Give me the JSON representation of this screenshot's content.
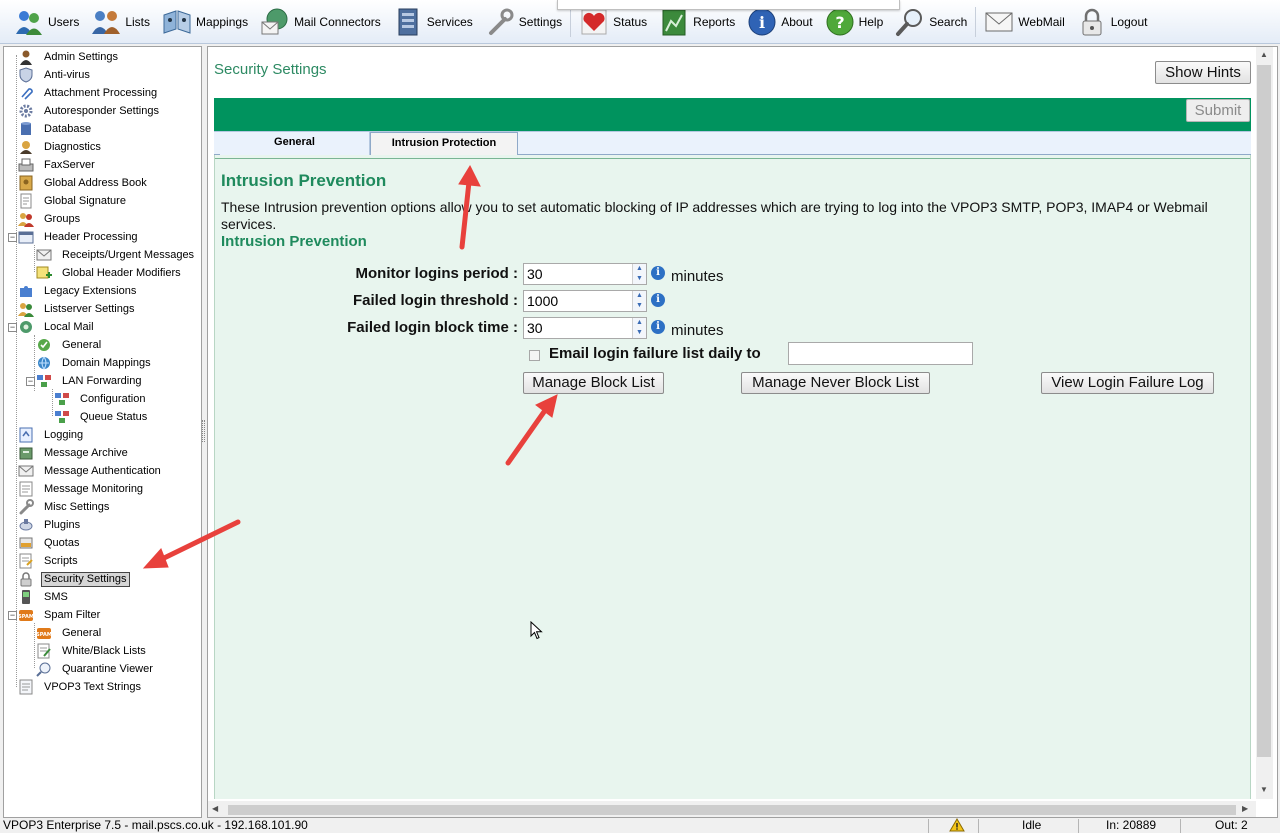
{
  "toolbar": {
    "items": [
      {
        "label": "Users",
        "icon": "users-icon"
      },
      {
        "label": "Lists",
        "icon": "lists-icon"
      },
      {
        "label": "Mappings",
        "icon": "mappings-icon"
      },
      {
        "label": "Mail Connectors",
        "icon": "mail-connectors-icon"
      },
      {
        "label": "Services",
        "icon": "services-icon"
      },
      {
        "label": "Settings",
        "icon": "wrench-icon"
      },
      {
        "label": "Status",
        "icon": "heart-icon"
      },
      {
        "label": "Reports",
        "icon": "reports-icon"
      },
      {
        "label": "About",
        "icon": "info-icon"
      },
      {
        "label": "Help",
        "icon": "help-icon"
      },
      {
        "label": "Search",
        "icon": "magnifier-icon"
      },
      {
        "label": "WebMail",
        "icon": "webmail-icon"
      },
      {
        "label": "Logout",
        "icon": "padlock-icon"
      }
    ]
  },
  "tree": {
    "items": [
      {
        "label": "Admin Settings",
        "icon": "admin-icon"
      },
      {
        "label": "Anti-virus",
        "icon": "shield-icon"
      },
      {
        "label": "Attachment Processing",
        "icon": "paperclip-icon"
      },
      {
        "label": "Autoresponder Settings",
        "icon": "gear-icon"
      },
      {
        "label": "Database",
        "icon": "database-icon"
      },
      {
        "label": "Diagnostics",
        "icon": "diagnostics-icon"
      },
      {
        "label": "FaxServer",
        "icon": "fax-icon"
      },
      {
        "label": "Global Address Book",
        "icon": "address-book-icon"
      },
      {
        "label": "Global Signature",
        "icon": "document-icon"
      },
      {
        "label": "Groups",
        "icon": "groups-icon"
      },
      {
        "label": "Header Processing",
        "icon": "header-icon"
      },
      {
        "label": "Receipts/Urgent Messages",
        "icon": "receipt-icon"
      },
      {
        "label": "Global Header Modifiers",
        "icon": "modifier-icon"
      },
      {
        "label": "Legacy Extensions",
        "icon": "puzzle-icon"
      },
      {
        "label": "Listserver Settings",
        "icon": "listserver-icon"
      },
      {
        "label": "Local Mail",
        "icon": "local-mail-icon"
      },
      {
        "label": "General",
        "icon": "general-icon"
      },
      {
        "label": "Domain Mappings",
        "icon": "globe-icon"
      },
      {
        "label": "LAN Forwarding",
        "icon": "lan-icon"
      },
      {
        "label": "Configuration",
        "icon": "configuration-icon"
      },
      {
        "label": "Queue Status",
        "icon": "queue-icon"
      },
      {
        "label": "Logging",
        "icon": "logging-icon"
      },
      {
        "label": "Message Archive",
        "icon": "archive-icon"
      },
      {
        "label": "Message Authentication",
        "icon": "authentication-icon"
      },
      {
        "label": "Message Monitoring",
        "icon": "monitoring-icon"
      },
      {
        "label": "Misc Settings",
        "icon": "misc-icon"
      },
      {
        "label": "Plugins",
        "icon": "plugin-icon"
      },
      {
        "label": "Quotas",
        "icon": "quota-icon"
      },
      {
        "label": "Scripts",
        "icon": "script-icon"
      },
      {
        "label": "Security Settings",
        "icon": "lock-icon"
      },
      {
        "label": "SMS",
        "icon": "phone-icon"
      },
      {
        "label": "Spam Filter",
        "icon": "spam-icon"
      },
      {
        "label": "General",
        "icon": "spam-general-icon"
      },
      {
        "label": "White/Black Lists",
        "icon": "whitelist-icon"
      },
      {
        "label": "Quarantine Viewer",
        "icon": "quarantine-icon"
      },
      {
        "label": "VPOP3 Text Strings",
        "icon": "text-strings-icon"
      }
    ],
    "selected": "Security Settings"
  },
  "main": {
    "title": "Security Settings",
    "show_hints_label": "Show Hints",
    "submit_label": "Submit",
    "tabs": [
      {
        "label": "General",
        "active": false
      },
      {
        "label": "Intrusion Protection",
        "active": true
      }
    ],
    "section_heading": "Intrusion Prevention",
    "description": "These Intrusion prevention options allow you to set automatic blocking of IP addresses which are trying to log into the VPOP3 SMTP, POP3, IMAP4 or Webmail services.",
    "sub_heading": "Intrusion Prevention",
    "fields": {
      "monitor_period": {
        "label": "Monitor logins period :",
        "value": "30",
        "unit": "minutes"
      },
      "failed_threshold": {
        "label": "Failed login threshold :",
        "value": "1000"
      },
      "block_time": {
        "label": "Failed login block time :",
        "value": "30",
        "unit": "minutes"
      }
    },
    "email_daily": {
      "label": "Email login failure list daily to",
      "checked": false,
      "value": ""
    },
    "buttons": {
      "manage_block": "Manage Block List",
      "manage_never_block": "Manage Never Block List",
      "view_failure_log": "View Login Failure Log"
    }
  },
  "status_bar": {
    "app_info": "VPOP3 Enterprise 7.5 - mail.pscs.co.uk - 192.168.101.90",
    "state": "Idle",
    "in_label": "In: 20889",
    "out_label": "Out: 2"
  },
  "colors": {
    "accent_green": "#00935e",
    "heading_green": "#1f8a5d",
    "content_bg": "#e8f5ee",
    "annotation_arrow": "#e8413c"
  }
}
